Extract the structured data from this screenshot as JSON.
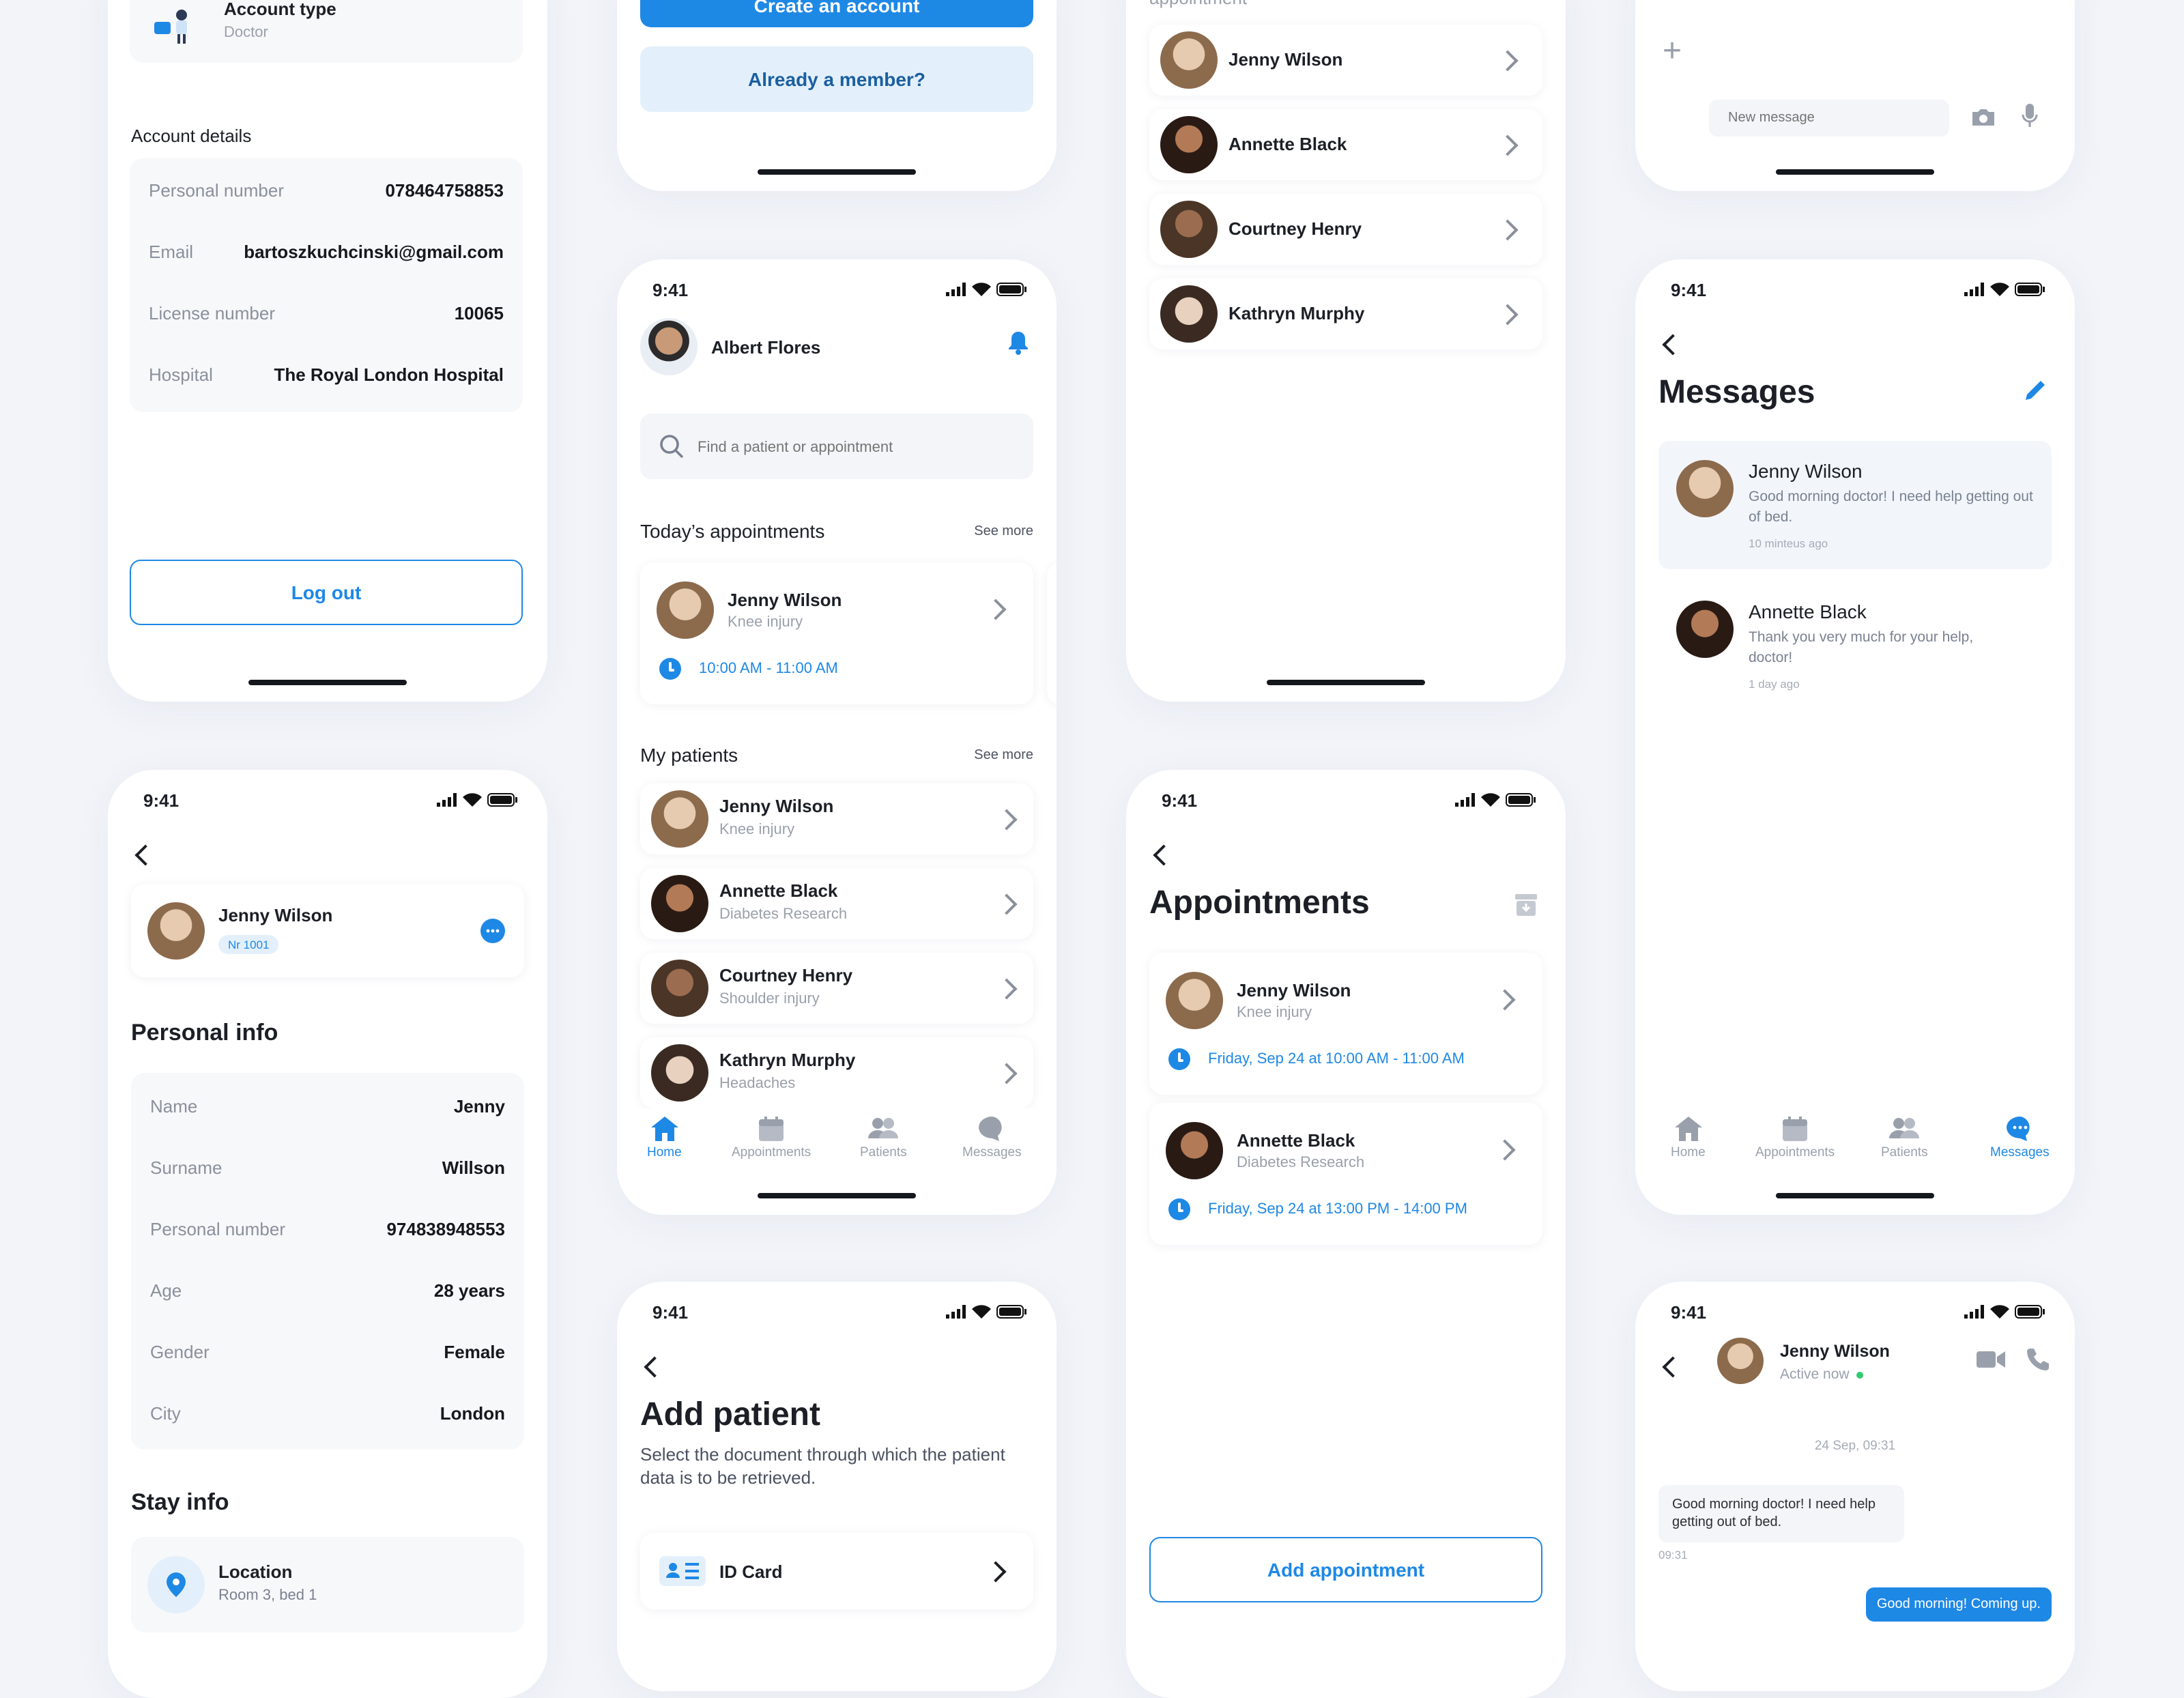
{
  "status_time": "9:41",
  "colors": {
    "accent": "#1e88e5",
    "background": "#f2f4f9",
    "online": "#2ecc71"
  },
  "screen_a": {
    "account_type_label": "Account type",
    "account_type_value": "Doctor",
    "section_title": "Account details",
    "rows": [
      {
        "label": "Personal number",
        "value": "078464758853"
      },
      {
        "label": "Email",
        "value": "bartoszkuchcinski@gmail.com"
      },
      {
        "label": "License number",
        "value": "10065"
      },
      {
        "label": "Hospital",
        "value": "The Royal London Hospital"
      }
    ],
    "logout": "Log out"
  },
  "screen_b": {
    "create_account": "Create an account",
    "already_member": "Already a member?"
  },
  "screen_c": {
    "header_fragment": "appointment",
    "patients": [
      "Jenny Wilson",
      "Annette Black",
      "Courtney Henry",
      "Kathryn Murphy"
    ]
  },
  "screen_d": {
    "plus": "+",
    "placeholder": "New message"
  },
  "home": {
    "user_name": "Albert Flores",
    "search_placeholder": "Find a patient or appointment",
    "todays_title": "Today’s appointments",
    "see_more": "See more",
    "appointment": {
      "name": "Jenny Wilson",
      "reason": "Knee injury",
      "time": "10:00 AM - 11:00 AM"
    },
    "patients_title": "My patients",
    "patients": [
      {
        "name": "Jenny Wilson",
        "reason": "Knee injury"
      },
      {
        "name": "Annette Black",
        "reason": "Diabetes Research"
      },
      {
        "name": "Courtney Henry",
        "reason": "Shoulder injury"
      },
      {
        "name": "Kathryn Murphy",
        "reason": "Headaches"
      }
    ],
    "tabs": [
      "Home",
      "Appointments",
      "Patients",
      "Messages"
    ]
  },
  "messages": {
    "title": "Messages",
    "items": [
      {
        "name": "Jenny Wilson",
        "text": "Good morning doctor! I need help getting out of bed.",
        "time": "10 minteus ago"
      },
      {
        "name": "Annette Black",
        "text": "Thank you very much for your help, doctor!",
        "time": "1 day ago"
      }
    ],
    "tabs": [
      "Home",
      "Appointments",
      "Patients",
      "Messages"
    ]
  },
  "patient": {
    "name": "Jenny Wilson",
    "badge": "Nr 1001",
    "personal_title": "Personal info",
    "rows": [
      {
        "label": "Name",
        "value": "Jenny"
      },
      {
        "label": "Surname",
        "value": "Willson"
      },
      {
        "label": "Personal number",
        "value": "974838948553"
      },
      {
        "label": "Age",
        "value": "28 years"
      },
      {
        "label": "Gender",
        "value": "Female"
      },
      {
        "label": "City",
        "value": "London"
      }
    ],
    "stay_title": "Stay info",
    "location_label": "Location",
    "location_value": "Room 3, bed 1"
  },
  "appointments": {
    "title": "Appointments",
    "items": [
      {
        "name": "Jenny Wilson",
        "reason": "Knee injury",
        "time": "Friday, Sep 24 at 10:00 AM - 11:00 AM"
      },
      {
        "name": "Annette Black",
        "reason": "Diabetes Research",
        "time": "Friday, Sep 24 at 13:00 PM - 14:00 PM"
      }
    ],
    "add_button": "Add appointment"
  },
  "add_patient": {
    "title": "Add patient",
    "description": "Select the document through which the patient data is to be retrieved.",
    "option": "ID Card"
  },
  "chat": {
    "name": "Jenny Wilson",
    "status": "Active now",
    "date": "24 Sep, 09:31",
    "incoming": "Good morning doctor! I need help getting out of bed.",
    "incoming_time": "09:31",
    "outgoing": "Good morning! Coming up."
  }
}
